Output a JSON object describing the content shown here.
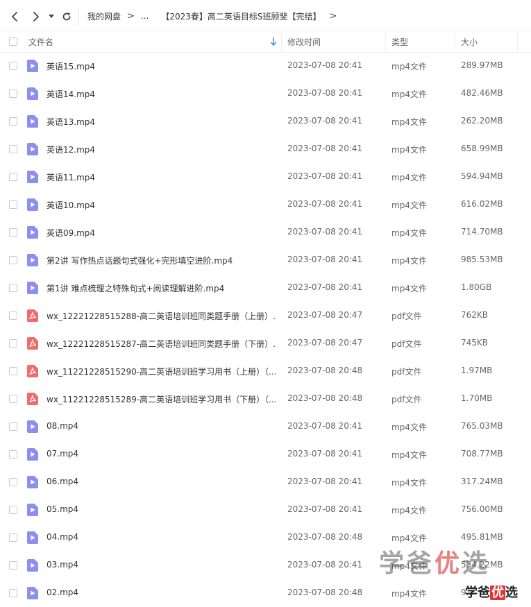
{
  "breadcrumb": {
    "root": "我的网盘",
    "ellipsis": "...",
    "current": "【2023春】高二英语目标S班顾斐【完结】"
  },
  "columns": {
    "name": "文件名",
    "modified": "修改时间",
    "type": "类型",
    "size": "大小"
  },
  "files": [
    {
      "name": "英语15.mp4",
      "modified": "2023-07-08 20:41",
      "type": "mp4文件",
      "size": "289.97MB",
      "icon": "video"
    },
    {
      "name": "英语14.mp4",
      "modified": "2023-07-08 20:41",
      "type": "mp4文件",
      "size": "482.46MB",
      "icon": "video"
    },
    {
      "name": "英语13.mp4",
      "modified": "2023-07-08 20:41",
      "type": "mp4文件",
      "size": "262.20MB",
      "icon": "video"
    },
    {
      "name": "英语12.mp4",
      "modified": "2023-07-08 20:41",
      "type": "mp4文件",
      "size": "658.99MB",
      "icon": "video"
    },
    {
      "name": "英语11.mp4",
      "modified": "2023-07-08 20:41",
      "type": "mp4文件",
      "size": "594.94MB",
      "icon": "video"
    },
    {
      "name": "英语10.mp4",
      "modified": "2023-07-08 20:41",
      "type": "mp4文件",
      "size": "616.02MB",
      "icon": "video"
    },
    {
      "name": "英语09.mp4",
      "modified": "2023-07-08 20:41",
      "type": "mp4文件",
      "size": "714.70MB",
      "icon": "video"
    },
    {
      "name": "第2讲 写作热点话题句式强化+完形填空进阶.mp4",
      "modified": "2023-07-08 20:41",
      "type": "mp4文件",
      "size": "985.53MB",
      "icon": "video"
    },
    {
      "name": "第1讲 难点梳理之特殊句式+阅读理解进阶.mp4",
      "modified": "2023-07-08 20:41",
      "type": "mp4文件",
      "size": "1.80GB",
      "icon": "video"
    },
    {
      "name": "wx_12221228515288-高二英语培训班同类题手册（上册）...",
      "modified": "2023-07-08 20:47",
      "type": "pdf文件",
      "size": "762KB",
      "icon": "pdf"
    },
    {
      "name": "wx_12221228515287-高二英语培训班同类题手册（下册）...",
      "modified": "2023-07-08 20:47",
      "type": "pdf文件",
      "size": "745KB",
      "icon": "pdf"
    },
    {
      "name": "wx_11221228515290-高二英语培训班学习用书（上册）（...",
      "modified": "2023-07-08 20:48",
      "type": "pdf文件",
      "size": "1.97MB",
      "icon": "pdf"
    },
    {
      "name": "wx_11221228515289-高二英语培训班学习用书（下册）（...",
      "modified": "2023-07-08 20:48",
      "type": "pdf文件",
      "size": "1.70MB",
      "icon": "pdf"
    },
    {
      "name": "08.mp4",
      "modified": "2023-07-08 20:41",
      "type": "mp4文件",
      "size": "765.03MB",
      "icon": "video"
    },
    {
      "name": "07.mp4",
      "modified": "2023-07-08 20:41",
      "type": "mp4文件",
      "size": "708.77MB",
      "icon": "video"
    },
    {
      "name": "06.mp4",
      "modified": "2023-07-08 20:41",
      "type": "mp4文件",
      "size": "317.24MB",
      "icon": "video"
    },
    {
      "name": "05.mp4",
      "modified": "2023-07-08 20:41",
      "type": "mp4文件",
      "size": "756.00MB",
      "icon": "video"
    },
    {
      "name": "04.mp4",
      "modified": "2023-07-08 20:48",
      "type": "mp4文件",
      "size": "495.81MB",
      "icon": "video"
    },
    {
      "name": "03.mp4",
      "modified": "2023-07-08 20:41",
      "type": "mp4文件",
      "size": "534.22MB",
      "icon": "video"
    },
    {
      "name": "02.mp4",
      "modified": "2023-07-08 20:48",
      "type": "mp4文件",
      "size": "9...",
      "icon": "video"
    }
  ],
  "watermark": {
    "part1": "学爸",
    "part2": "优",
    "part3": "选"
  },
  "logo": {
    "part1": "学爸",
    "part2": "优",
    "part3": "选"
  },
  "colors": {
    "video_icon": "#8a8ff0",
    "pdf_icon": "#f06b6b",
    "sort_arrow": "#3d8bfd"
  }
}
